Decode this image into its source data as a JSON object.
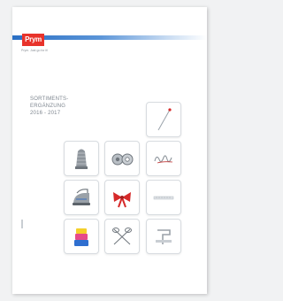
{
  "brand": {
    "logo_text": "Prym",
    "tagline": "Prym. Just go for it!"
  },
  "heading": {
    "line1": "SORTIMENTS-",
    "line2": "ERGÄNZUNG",
    "line3": "2016 - 2017"
  },
  "tiles": [
    {
      "icon": "needle-icon"
    },
    {
      "icon": "thimble-icon"
    },
    {
      "icon": "snap-fastener-icon"
    },
    {
      "icon": "safety-pin-icon"
    },
    {
      "icon": "iron-icon"
    },
    {
      "icon": "ribbon-bow-icon"
    },
    {
      "icon": "ruler-icon"
    },
    {
      "icon": "colored-bobbins-icon"
    },
    {
      "icon": "scissors-icon"
    },
    {
      "icon": "hook-fastener-icon"
    }
  ],
  "colors": {
    "brand_red": "#e8332b",
    "band_blue": "#2a6fc4",
    "text_grey": "#7f8790"
  }
}
